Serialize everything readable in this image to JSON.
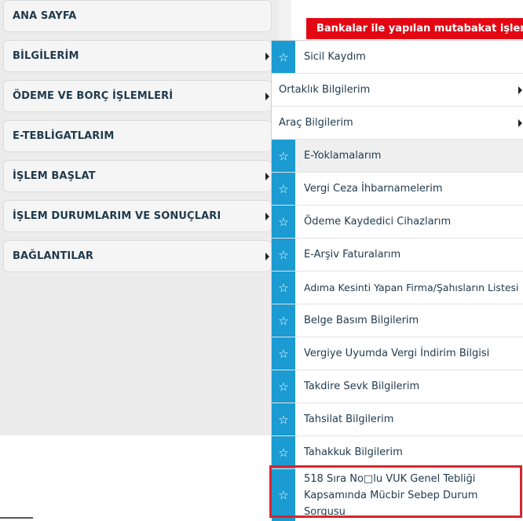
{
  "nav": {
    "items": [
      {
        "label": "ANA SAYFA",
        "arrow": false
      },
      {
        "label": "BİLGİLERİM",
        "arrow": true
      },
      {
        "label": "ÖDEME VE BORÇ İŞLEMLERİ",
        "arrow": true
      },
      {
        "label": "E-TEBLİGATLARIM",
        "arrow": false
      },
      {
        "label": "İŞLEM BAŞLAT",
        "arrow": true
      },
      {
        "label": "İŞLEM DURUMLARIM VE SONUÇLARI",
        "arrow": true
      },
      {
        "label": "BAĞLANTILAR",
        "arrow": true
      }
    ]
  },
  "banner": {
    "text": "Bankalar ile yapılan mutabakat işlemleri n"
  },
  "submenu": {
    "items": [
      {
        "label": "Sicil Kaydım",
        "icon": "star-icon"
      },
      {
        "label": "Ortaklık Bilgilerim",
        "icon": "chevron-right-icon"
      },
      {
        "label": "Araç Bilgilerim",
        "icon": "chevron-right-icon"
      },
      {
        "label": "E-Yoklamalarım",
        "icon": "star-icon"
      },
      {
        "label": "Vergi Ceza İhbarnamelerim",
        "icon": "star-icon"
      },
      {
        "label": "Ödeme Kaydedici Cihazlarım",
        "icon": "star-icon"
      },
      {
        "label": "E-Arşiv Faturalarım",
        "icon": "star-icon"
      },
      {
        "label": "Adıma Kesinti Yapan Firma/Şahısların Listesi",
        "icon": "star-icon"
      },
      {
        "label": "Belge Basım Bilgilerim",
        "icon": "star-icon"
      },
      {
        "label": "Vergiye Uyumda Vergi İndirim Bilgisi",
        "icon": "star-icon"
      },
      {
        "label": "Takdire Sevk Bilgilerim",
        "icon": "star-icon"
      },
      {
        "label": "Tahsilat Bilgilerim",
        "icon": "star-icon"
      },
      {
        "label": "Tahakkuk Bilgilerim",
        "icon": "star-icon"
      },
      {
        "label_line1": "518 Sıra No□lu VUK Genel Tebliği",
        "label_line2": "Kapsamında Mücbir Sebep Durum Sorgusu",
        "icon": "star-icon"
      }
    ]
  },
  "colors": {
    "accent": "#1b9bd1",
    "alert": "#e30613",
    "highlight_outline": "#d7262e",
    "text": "#1f3a4d"
  }
}
